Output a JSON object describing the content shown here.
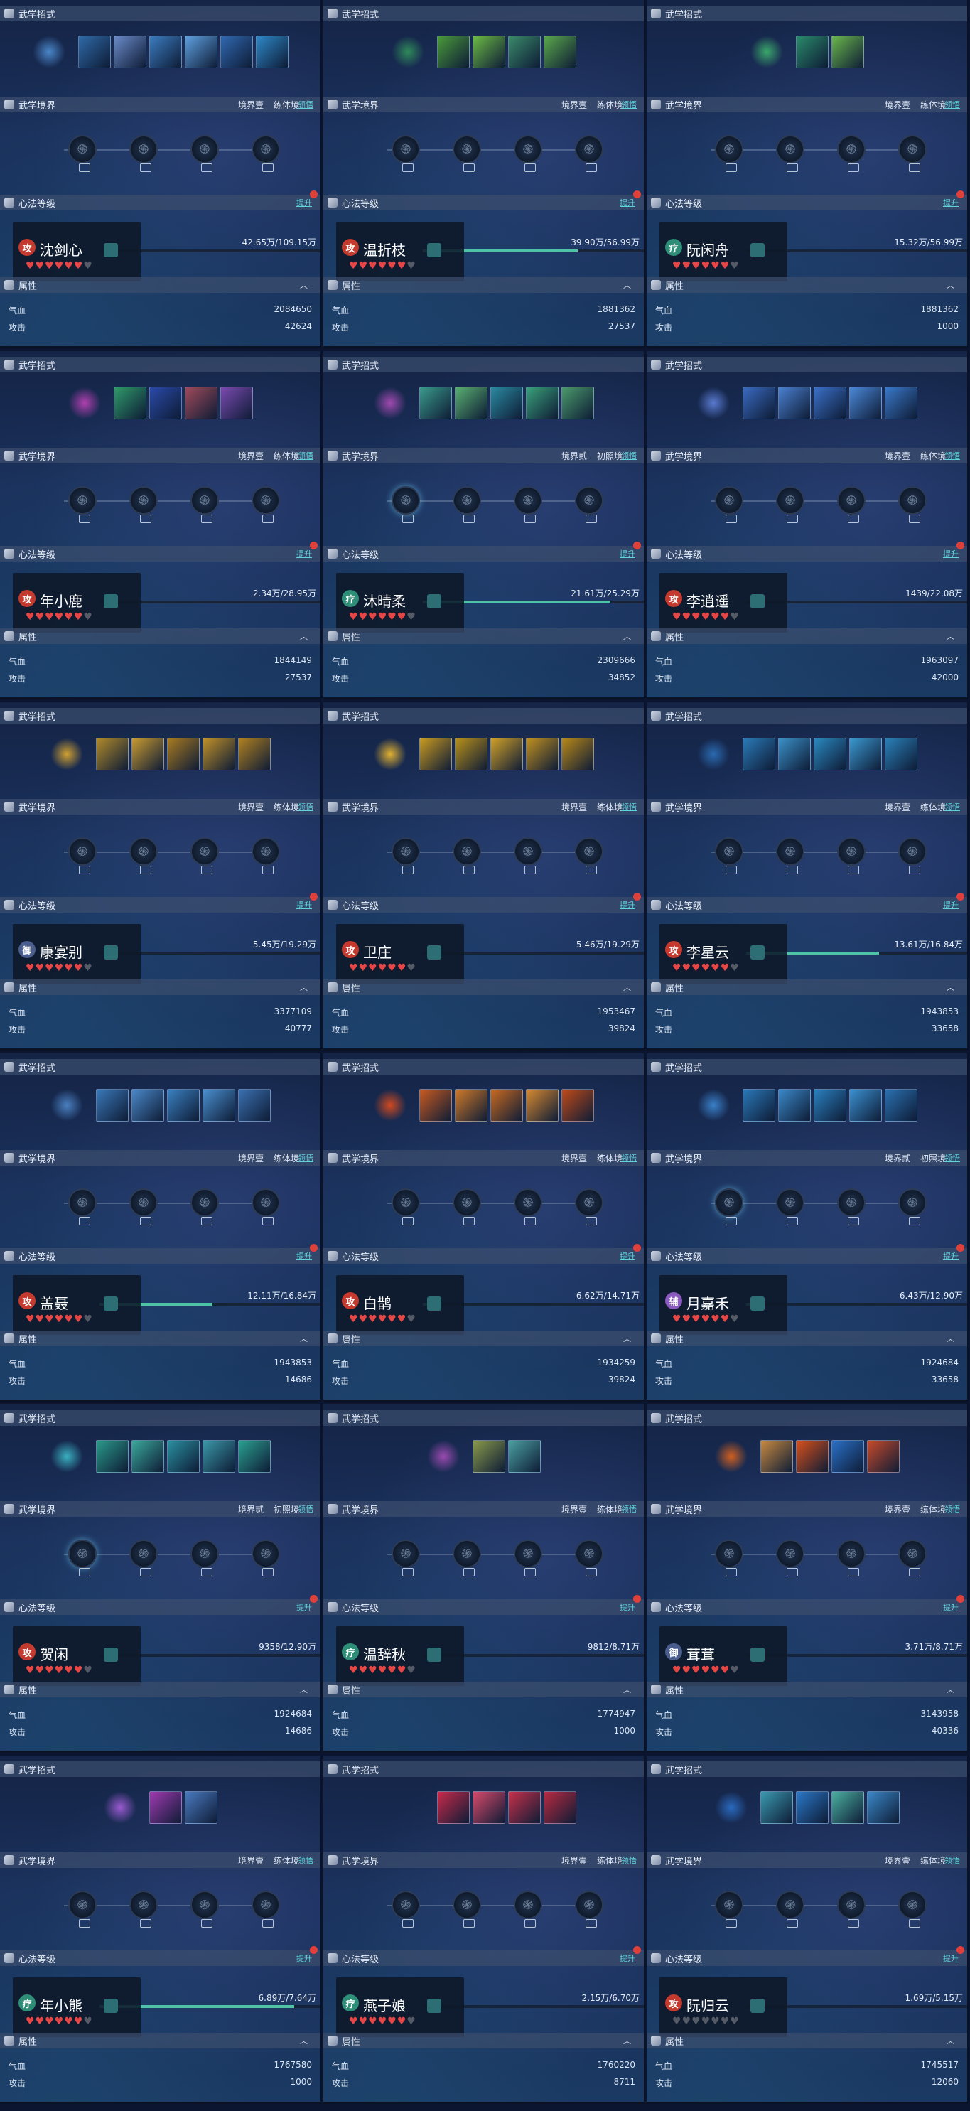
{
  "labels": {
    "skills_header": "武学招式",
    "realm_header": "武学境界",
    "realm_action": "领悟",
    "level_header": "心法等级",
    "level_action": "提升",
    "attr_header": "属性",
    "hp_label": "气血",
    "atk_label": "攻击"
  },
  "icons": {
    "header_icon": "martial-scroll-icon",
    "node_icon": "swirl-glyph-icon",
    "collapse_icon": "chevron-up-icon",
    "heart_icon": "heart-icon"
  },
  "colors": {
    "progress_fill": "#4fc3a8",
    "link": "#5fd3d9",
    "heart_on": "#e64646",
    "heart_off": "#555b66",
    "role_attack": "#c43a2e",
    "role_heal": "#2f8e78",
    "role_defense": "#4a5d8c",
    "role_support": "#8a5abf"
  },
  "characters": [
    {
      "name": "沈剑心",
      "role": "攻",
      "role_type": "attack",
      "realm": [
        "境界壹",
        "练体境"
      ],
      "progress_text": "42.65万/109.15万",
      "progress": 0.0,
      "hearts": 6,
      "hp": "2084650",
      "atk": "42624",
      "skills": [
        "#2f6aa8",
        "#6a8ac8",
        "#3b7cc0",
        "#5ea0e0",
        "#3068b0",
        "#2e88c8"
      ],
      "main_skill": "#4a86c8",
      "realm_lit": 0
    },
    {
      "name": "温折枝",
      "role": "攻",
      "role_type": "attack",
      "realm": [
        "境界壹",
        "练体境"
      ],
      "progress_text": "39.90万/56.99万",
      "progress": 0.7,
      "hearts": 6,
      "hp": "1881362",
      "atk": "27537",
      "skills": [
        "#4a9a3a",
        "#6cba44",
        "#3a8a6a",
        "#5aa84a"
      ],
      "main_skill": "#2f8a5a",
      "realm_lit": 0
    },
    {
      "name": "阮闲舟",
      "role": "疗",
      "role_type": "heal",
      "realm": [
        "境界壹",
        "练体境"
      ],
      "progress_text": "15.32万/56.99万",
      "progress": 0.0,
      "hearts": 6,
      "hp": "1881362",
      "atk": "1000",
      "skills": [
        "#2a8a6a",
        "#6ab84a"
      ],
      "main_skill": "#3aa86a",
      "realm_lit": 0
    },
    {
      "name": "年小鹿",
      "role": "攻",
      "role_type": "attack",
      "realm": [
        "境界壹",
        "练体境"
      ],
      "progress_text": "2.34万/28.95万",
      "progress": 0.0,
      "hearts": 6,
      "hp": "1844149",
      "atk": "27537",
      "skills": [
        "#2f9a6a",
        "#2a4aa8",
        "#a04a5a",
        "#7a4ab0"
      ],
      "main_skill": "#b040b0",
      "realm_lit": 0
    },
    {
      "name": "沐晴柔",
      "role": "疗",
      "role_type": "heal",
      "realm": [
        "境界贰",
        "初照境"
      ],
      "progress_text": "21.61万/25.29万",
      "progress": 0.85,
      "hearts": 6,
      "hp": "2309666",
      "atk": "34852",
      "skills": [
        "#3a9a8a",
        "#5ab070",
        "#2a8aa0",
        "#3aa07a",
        "#4a9a6a"
      ],
      "main_skill": "#a04ab0",
      "realm_lit": 1
    },
    {
      "name": "李逍遥",
      "role": "攻",
      "role_type": "attack",
      "realm": [
        "境界壹",
        "练体境"
      ],
      "progress_text": "1439/22.08万",
      "progress": 0.0,
      "hearts": 6,
      "hp": "1963097",
      "atk": "42000",
      "skills": [
        "#3a6ac0",
        "#4a80d0",
        "#3a70c8",
        "#4a88d8",
        "#3a78c8"
      ],
      "main_skill": "#5a7ad0",
      "realm_lit": 0
    },
    {
      "name": "康宴别",
      "role": "御",
      "role_type": "defense",
      "realm": [
        "境界壹",
        "练体境"
      ],
      "progress_text": "5.45万/19.29万",
      "progress": 0.0,
      "hearts": 6,
      "hp": "3377109",
      "atk": "40777",
      "skills": [
        "#b08a2a",
        "#c89a30",
        "#a87a20",
        "#c09028",
        "#b08020"
      ],
      "main_skill": "#d0a030",
      "realm_lit": 0
    },
    {
      "name": "卫庄",
      "role": "攻",
      "role_type": "attack",
      "realm": [
        "境界壹",
        "练体境"
      ],
      "progress_text": "5.46万/19.29万",
      "progress": 0.0,
      "hearts": 6,
      "hp": "1953467",
      "atk": "39824",
      "skills": [
        "#c89a20",
        "#b8901a",
        "#d0a028",
        "#c09020",
        "#b88818"
      ],
      "main_skill": "#e0b030",
      "realm_lit": 0
    },
    {
      "name": "李星云",
      "role": "攻",
      "role_type": "attack",
      "realm": [
        "境界壹",
        "练体境"
      ],
      "progress_text": "13.61万/16.84万",
      "progress": 0.6,
      "hearts": 6,
      "hp": "1943853",
      "atk": "33658",
      "skills": [
        "#2a7ab8",
        "#3a90c8",
        "#2a88c0",
        "#3a98d0",
        "#2a80b8"
      ],
      "main_skill": "#2a6ab0",
      "realm_lit": 0
    },
    {
      "name": "盖聂",
      "role": "攻",
      "role_type": "attack",
      "realm": [
        "境界壹",
        "练体境"
      ],
      "progress_text": "12.11万/16.84万",
      "progress": 0.51,
      "hearts": 6,
      "hp": "1943853",
      "atk": "14686",
      "skills": [
        "#3a78b8",
        "#4a88c8",
        "#3a80c0",
        "#4a90d0",
        "#3a70b0"
      ],
      "main_skill": "#4a80c0",
      "realm_lit": 0
    },
    {
      "name": "白鹊",
      "role": "攻",
      "role_type": "attack",
      "realm": [
        "境界壹",
        "练体境"
      ],
      "progress_text": "6.62万/14.71万",
      "progress": 0.03,
      "hearts": 6,
      "hp": "1934259",
      "atk": "39824",
      "skills": [
        "#c85a20",
        "#d07a28",
        "#c86a20",
        "#d88a30",
        "#c04a18"
      ],
      "main_skill": "#d04a20",
      "realm_lit": 0
    },
    {
      "name": "月嘉禾",
      "role": "辅",
      "role_type": "support",
      "realm": [
        "境界贰",
        "初照境"
      ],
      "progress_text": "6.43万/12.90万",
      "progress": 0.05,
      "hearts": 6,
      "hp": "1924684",
      "atk": "33658",
      "skills": [
        "#2a78b8",
        "#3a88c8",
        "#2a80c0",
        "#3a90d0",
        "#2a70b0"
      ],
      "main_skill": "#3a80c8",
      "realm_lit": 1
    },
    {
      "name": "贺闲",
      "role": "攻",
      "role_type": "attack",
      "realm": [
        "境界贰",
        "初照境"
      ],
      "progress_text": "9358/12.90万",
      "progress": 0.0,
      "hearts": 6,
      "hp": "1924684",
      "atk": "14686",
      "skills": [
        "#2a9a8a",
        "#3aa89a",
        "#2a90a0",
        "#3a98a8",
        "#2aa090"
      ],
      "main_skill": "#3ab0c0",
      "realm_lit": 1
    },
    {
      "name": "温辞秋",
      "role": "疗",
      "role_type": "heal",
      "realm": [
        "境界壹",
        "练体境"
      ],
      "progress_text": "9812/8.71万",
      "progress": 0.0,
      "hearts": 6,
      "hp": "1774947",
      "atk": "1000",
      "skills": [
        "#8a9a4a",
        "#4aa0a0"
      ],
      "main_skill": "#9a4ab0",
      "realm_lit": 0
    },
    {
      "name": "茸茸",
      "role": "御",
      "role_type": "defense",
      "realm": [
        "境界壹",
        "练体境"
      ],
      "progress_text": "3.71万/8.71万",
      "progress": 0.0,
      "hearts": 6,
      "hp": "3143958",
      "atk": "40336",
      "skills": [
        "#c88a40",
        "#d8501a",
        "#2a70c8",
        "#c84a2a"
      ],
      "main_skill": "#d06020",
      "realm_lit": 0
    },
    {
      "name": "年小熊",
      "role": "疗",
      "role_type": "heal",
      "realm": [
        "境界壹",
        "练体境"
      ],
      "progress_text": "6.89万/7.64万",
      "progress": 0.88,
      "hearts": 6,
      "hp": "1767580",
      "atk": "1000",
      "skills": [
        "#a03ab0",
        "#4a7ac0"
      ],
      "main_skill": "#9a5ad0",
      "realm_lit": 0
    },
    {
      "name": "燕子娘",
      "role": "疗",
      "role_type": "heal",
      "realm": [
        "境界壹",
        "练体境"
      ],
      "progress_text": "2.15万/6.70万",
      "progress": 0.0,
      "hearts": 6,
      "hp": "1760220",
      "atk": "8711",
      "skills": [
        "#c82a4a",
        "#d84a6a",
        "#c8304a",
        "#b82a40"
      ],
      "main_skill": "",
      "realm_lit": 0
    },
    {
      "name": "阮归云",
      "role": "攻",
      "role_type": "attack",
      "realm": [
        "境界壹",
        "练体境"
      ],
      "progress_text": "1.69万/5.15万",
      "progress": 0.0,
      "hearts": 0,
      "hp": "1745517",
      "atk": "12060",
      "skills": [
        "#3a9ab0",
        "#2a78c8",
        "#4ab0a0",
        "#3a88c8"
      ],
      "main_skill": "#2a6ac0",
      "realm_lit": 0
    }
  ]
}
